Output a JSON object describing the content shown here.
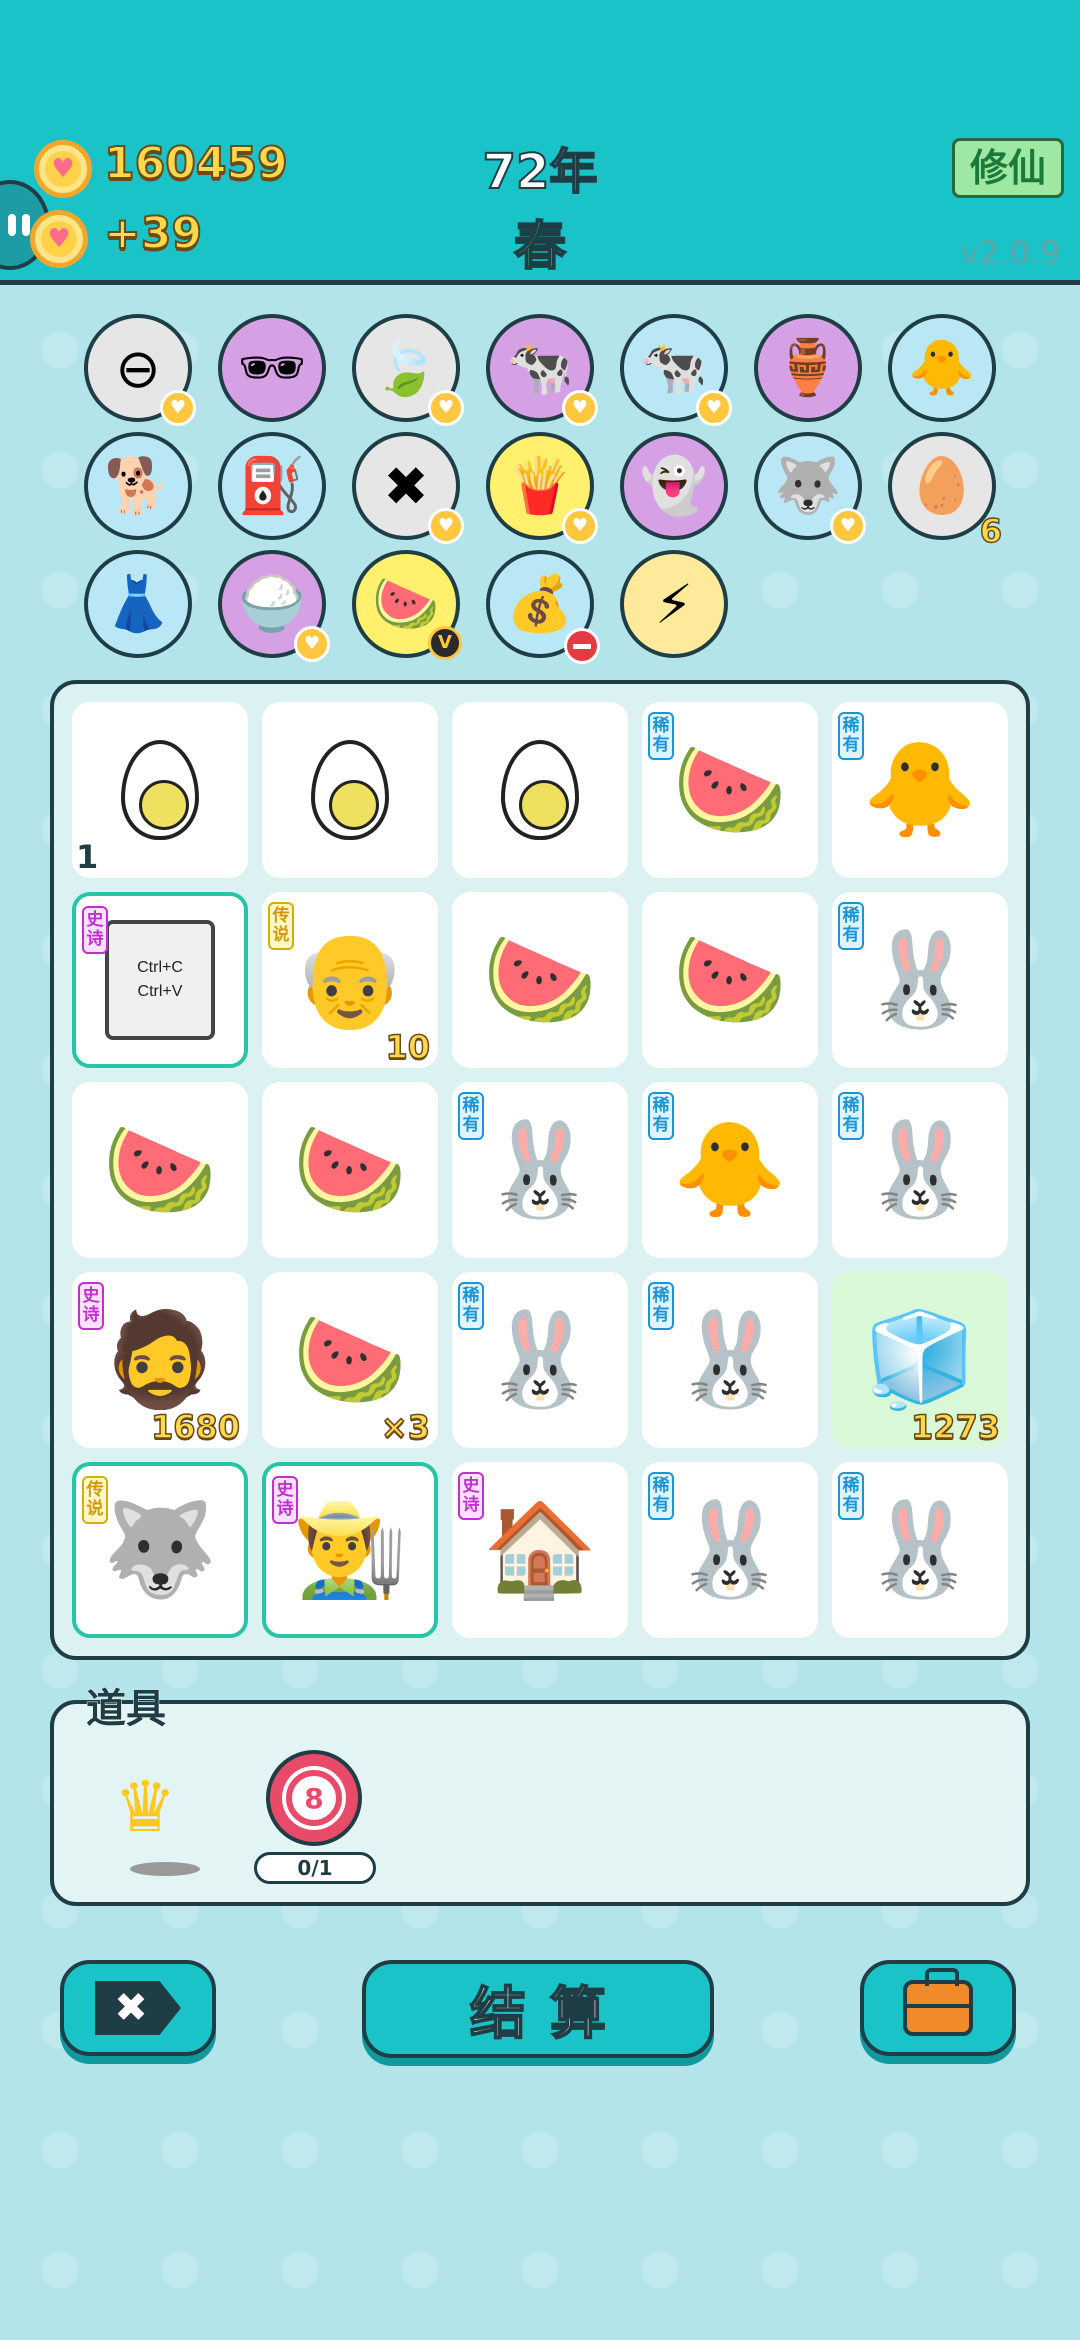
{
  "header": {
    "coins": "160459",
    "coin_income": "+39",
    "year": "72年",
    "season": "春",
    "mode_button": "修仙",
    "version": "v2.0.9"
  },
  "relics": [
    {
      "icon": "no-entry-icon",
      "glyph": "⊖",
      "bg": "#e6e6e6",
      "badge": "heart"
    },
    {
      "icon": "eye-patch-icon",
      "glyph": "🕶",
      "bg": "#d6a1e4",
      "badge": ""
    },
    {
      "icon": "leaf-icon",
      "glyph": "🍃",
      "bg": "#e6e6e6",
      "badge": "heart"
    },
    {
      "icon": "cow-pair-icon",
      "glyph": "🐄",
      "bg": "#d6a1e4",
      "badge": "heart"
    },
    {
      "icon": "cow-pair-icon",
      "glyph": "🐄",
      "bg": "#b9e7f6",
      "badge": "heart"
    },
    {
      "icon": "jar-icon",
      "glyph": "🏺",
      "bg": "#d6a1e4",
      "badge": ""
    },
    {
      "icon": "chick-egg-icon",
      "glyph": "🐥",
      "bg": "#b9e7f6",
      "badge": ""
    },
    {
      "icon": "cool-dog-icon",
      "glyph": "🐕",
      "bg": "#b9e7f6",
      "badge": ""
    },
    {
      "icon": "pump-icon",
      "glyph": "⛽",
      "bg": "#b9e7f6",
      "badge": ""
    },
    {
      "icon": "delete-tag-icon",
      "glyph": "✖",
      "bg": "#e6e6e6",
      "badge": "heart"
    },
    {
      "icon": "fries-icon",
      "glyph": "🍟",
      "bg": "#fff06e",
      "badge": "heart"
    },
    {
      "icon": "ghost-icon",
      "glyph": "👻",
      "bg": "#d6a1e4",
      "badge": ""
    },
    {
      "icon": "husky-icon",
      "glyph": "🐺",
      "bg": "#b9e7f6",
      "badge": "heart"
    },
    {
      "icon": "egg-carton-icon",
      "glyph": "🥚",
      "bg": "#e6e6e6",
      "badge": "",
      "count": "6"
    },
    {
      "icon": "skirt-icon",
      "glyph": "👗",
      "bg": "#b9e7f6",
      "badge": ""
    },
    {
      "icon": "rice-bowl-icon",
      "glyph": "🍚",
      "bg": "#d6a1e4",
      "badge": "heart"
    },
    {
      "icon": "fruit-basket-icon",
      "glyph": "🍉",
      "bg": "#fff06e",
      "badge": "v"
    },
    {
      "icon": "seed-bag-icon",
      "glyph": "💰",
      "bg": "#b9e7f6",
      "badge": "minus"
    },
    {
      "icon": "lightning-icon",
      "glyph": "⚡",
      "bg": "#ffe99a",
      "badge": ""
    }
  ],
  "rarity_labels": {
    "rare": "稀有",
    "epic": "史诗",
    "legendary": "传说"
  },
  "cells": [
    {
      "icon": "egg-icon",
      "kind": "egg",
      "count": "1"
    },
    {
      "icon": "egg-icon",
      "kind": "egg"
    },
    {
      "icon": "egg-icon",
      "kind": "egg"
    },
    {
      "icon": "watermelon-icon",
      "glyph": "🍉",
      "rarity": "rare"
    },
    {
      "icon": "chick-icon",
      "glyph": "🐥",
      "rarity": "rare"
    },
    {
      "icon": "ctrl-c-v-icon",
      "kind": "ctrl",
      "rarity": "epic",
      "highlight": true,
      "ctrl_c": "Ctrl+C",
      "ctrl_v": "Ctrl+V"
    },
    {
      "icon": "old-man-glasses-icon",
      "glyph": "👴",
      "rarity": "legendary",
      "value": "10"
    },
    {
      "icon": "watermelon-icon",
      "glyph": "🍉"
    },
    {
      "icon": "watermelon-icon",
      "glyph": "🍉"
    },
    {
      "icon": "rabbit-icon",
      "glyph": "🐰",
      "rarity": "rare"
    },
    {
      "icon": "watermelon-icon",
      "glyph": "🍉"
    },
    {
      "icon": "watermelon-icon",
      "glyph": "🍉"
    },
    {
      "icon": "rabbit-icon",
      "glyph": "🐰",
      "rarity": "rare"
    },
    {
      "icon": "chick-icon",
      "glyph": "🐥",
      "rarity": "rare"
    },
    {
      "icon": "rabbit-icon",
      "glyph": "🐰",
      "rarity": "rare"
    },
    {
      "icon": "bearded-man-icon",
      "glyph": "🧔",
      "rarity": "epic",
      "value": "1680"
    },
    {
      "icon": "watermelon-icon",
      "glyph": "🍉",
      "value": "×3"
    },
    {
      "icon": "rabbit-icon",
      "glyph": "🐰",
      "rarity": "rare"
    },
    {
      "icon": "rabbit-icon",
      "glyph": "🐰",
      "rarity": "rare"
    },
    {
      "icon": "fridge-icon",
      "glyph": "🧊",
      "green": true,
      "value": "1273"
    },
    {
      "icon": "husky-icon",
      "glyph": "🐺",
      "rarity": "legendary",
      "highlight": true
    },
    {
      "icon": "farmer-icon",
      "glyph": "👨‍🌾",
      "rarity": "epic",
      "highlight": true
    },
    {
      "icon": "rabbit-house-icon",
      "glyph": "🏠",
      "rarity": "epic"
    },
    {
      "icon": "rabbit-icon",
      "glyph": "🐰",
      "rarity": "rare"
    },
    {
      "icon": "rabbit-icon",
      "glyph": "🐰",
      "rarity": "rare"
    }
  ],
  "props": {
    "label": "道具",
    "target_number": "8",
    "target_count": "0/1"
  },
  "actions": {
    "delete_glyph": "✖",
    "settle_label": "结算"
  }
}
